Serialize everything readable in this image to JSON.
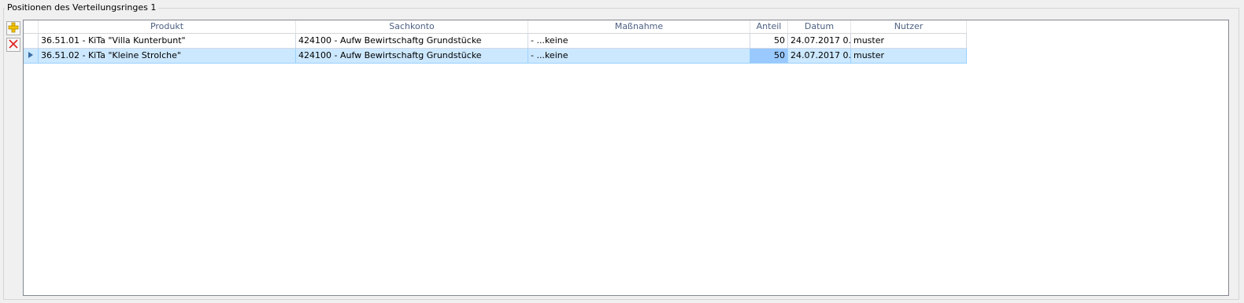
{
  "group": {
    "title": "Positionen des Verteilungsringes 1"
  },
  "toolbar": {
    "add_icon": "plus-icon",
    "delete_icon": "delete-x-icon"
  },
  "grid": {
    "columns": [
      "Produkt",
      "Sachkonto",
      "Maßnahme",
      "Anteil",
      "Datum",
      "Nutzer"
    ],
    "rows": [
      {
        "produkt": "36.51.01 - KiTa \"Villa Kunterbunt\"",
        "sachkonto": "424100 - Aufw Bewirtschaftg Grundstücke",
        "massnahme": "- ...keine",
        "anteil": "50",
        "datum": "24.07.2017  0...",
        "nutzer": "muster"
      },
      {
        "produkt": "36.51.02 - KiTa \"Kleine Strolche\"",
        "sachkonto": "424100 - Aufw Bewirtschaftg Grundstücke",
        "massnahme": "- ...keine",
        "anteil": "50",
        "datum": "24.07.2017  0...",
        "nutzer": "muster",
        "selected": true
      }
    ]
  },
  "colors": {
    "selection": "#cce8ff",
    "active_cell": "#99c9ff",
    "header_text": "#4d6082"
  }
}
